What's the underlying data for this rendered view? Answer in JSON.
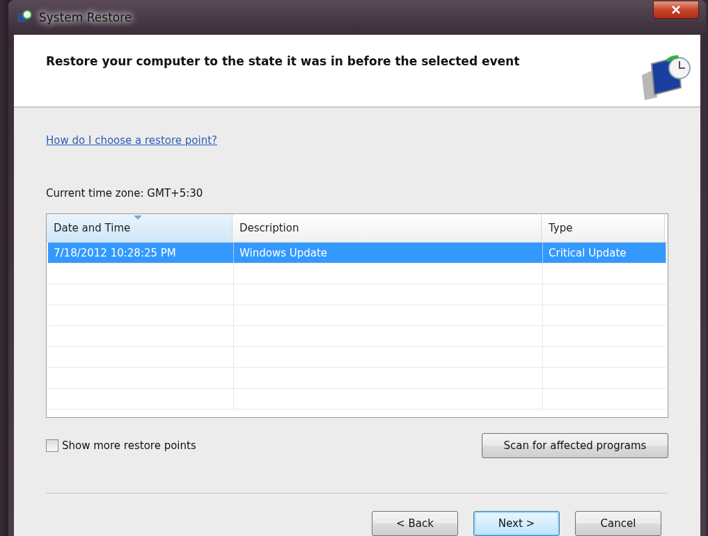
{
  "window": {
    "title": "System Restore"
  },
  "header": {
    "title": "Restore your computer to the state it was in before the selected event"
  },
  "help_link": "How do I choose a restore point?",
  "time_zone": "Current time zone: GMT+5:30",
  "table": {
    "columns": [
      {
        "label": "Date and Time",
        "sorted": true
      },
      {
        "label": "Description",
        "sorted": false
      },
      {
        "label": "Type",
        "sorted": false
      }
    ],
    "rows": [
      {
        "cells": [
          "7/18/2012 10:28:25 PM",
          "Windows Update",
          "Critical Update"
        ],
        "selected": true
      }
    ]
  },
  "show_more": {
    "label": "Show more restore points",
    "checked": false
  },
  "scan_button": {
    "label": "Scan for affected programs"
  },
  "buttons": [
    {
      "label": "< Back",
      "default": false
    },
    {
      "label": "Next >",
      "default": true
    },
    {
      "label": "Cancel",
      "default": false
    }
  ]
}
